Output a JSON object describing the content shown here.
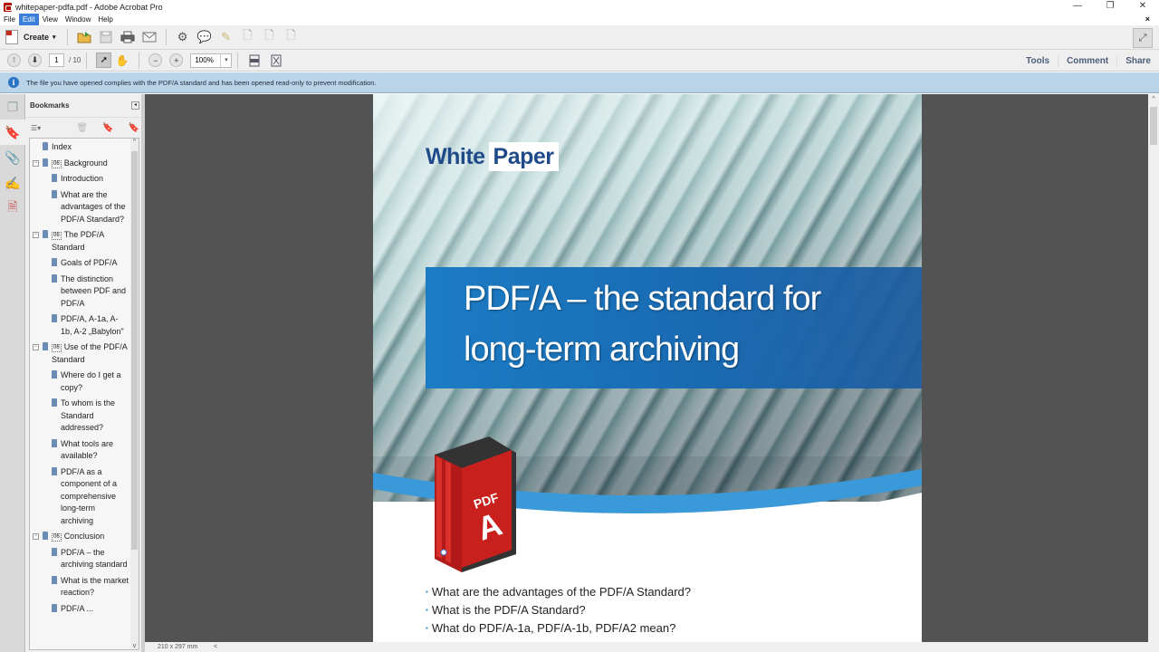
{
  "window": {
    "title": "whitepaper-pdfa.pdf - Adobe Acrobat Pro",
    "controls": {
      "minimize": "—",
      "restore": "❐",
      "close": "✕"
    }
  },
  "menu": {
    "items": [
      "File",
      "Edit",
      "View",
      "Window",
      "Help"
    ],
    "active": "Edit",
    "close_doc": "×"
  },
  "toolbar": {
    "create_label": "Create",
    "create_caret": "▾",
    "icons": [
      "open-icon",
      "save-icon",
      "print-icon",
      "email-icon",
      "settings-icon",
      "comment-icon",
      "highlight-icon",
      "file-delete-icon",
      "file-export-icon",
      "file-edit-icon"
    ],
    "expand_icon": "⤢"
  },
  "nav": {
    "page_current": "1",
    "page_total": "/ 10",
    "zoom_value": "100%",
    "zoom_caret": "▾",
    "right_links": [
      "Tools",
      "Comment",
      "Share"
    ]
  },
  "infobar": {
    "icon": "i",
    "message": "The file you have opened complies with the PDF/A standard and has been opened read-only to prevent modification."
  },
  "bookmarks": {
    "title": "Bookmarks",
    "options_icon": "☰▾",
    "items": [
      {
        "level": 0,
        "label": "Index",
        "toggle": false,
        "tag": false
      },
      {
        "level": 0,
        "label": "Background",
        "toggle": true,
        "tag": true
      },
      {
        "level": 1,
        "label": "Introduction"
      },
      {
        "level": 1,
        "label": "What are the advantages of the PDF/A Standard?"
      },
      {
        "level": 0,
        "label": "The PDF/A Standard",
        "toggle": true,
        "tag": true
      },
      {
        "level": 1,
        "label": "Goals of PDF/A"
      },
      {
        "level": 1,
        "label": "The distinction between PDF and PDF/A"
      },
      {
        "level": 1,
        "label": "PDF/A, A-1a, A-1b, A-2 „Babylon\""
      },
      {
        "level": 0,
        "label": "Use of the PDF/A Standard",
        "toggle": true,
        "tag": true
      },
      {
        "level": 1,
        "label": "Where do I get a copy?"
      },
      {
        "level": 1,
        "label": "To whom is the Standard addressed?"
      },
      {
        "level": 1,
        "label": "What tools are available?"
      },
      {
        "level": 1,
        "label": "PDF/A as a component of a comprehensive long-term archiving"
      },
      {
        "level": 0,
        "label": "Conclusion",
        "toggle": true,
        "tag": true
      },
      {
        "level": 1,
        "label": "PDF/A – the archiving standard"
      },
      {
        "level": 1,
        "label": "What is the market reaction?"
      },
      {
        "level": 1,
        "label": "PDF/A ..."
      }
    ]
  },
  "document": {
    "label_white": "White",
    "label_paper": "Paper",
    "headline_1": "PDF/A – the standard for",
    "headline_2": "long-term archiving",
    "binder_text": "PDF A",
    "bullets": [
      "What are the advantages of the PDF/A Standard?",
      "What is the PDF/A Standard?",
      "What do PDF/A-1a, PDF/A-1b, PDF/A2 mean?"
    ],
    "accent_color": "#1b7cc4"
  },
  "status": {
    "page_size": "210 x 297 mm",
    "h_scroll_left": "<"
  }
}
